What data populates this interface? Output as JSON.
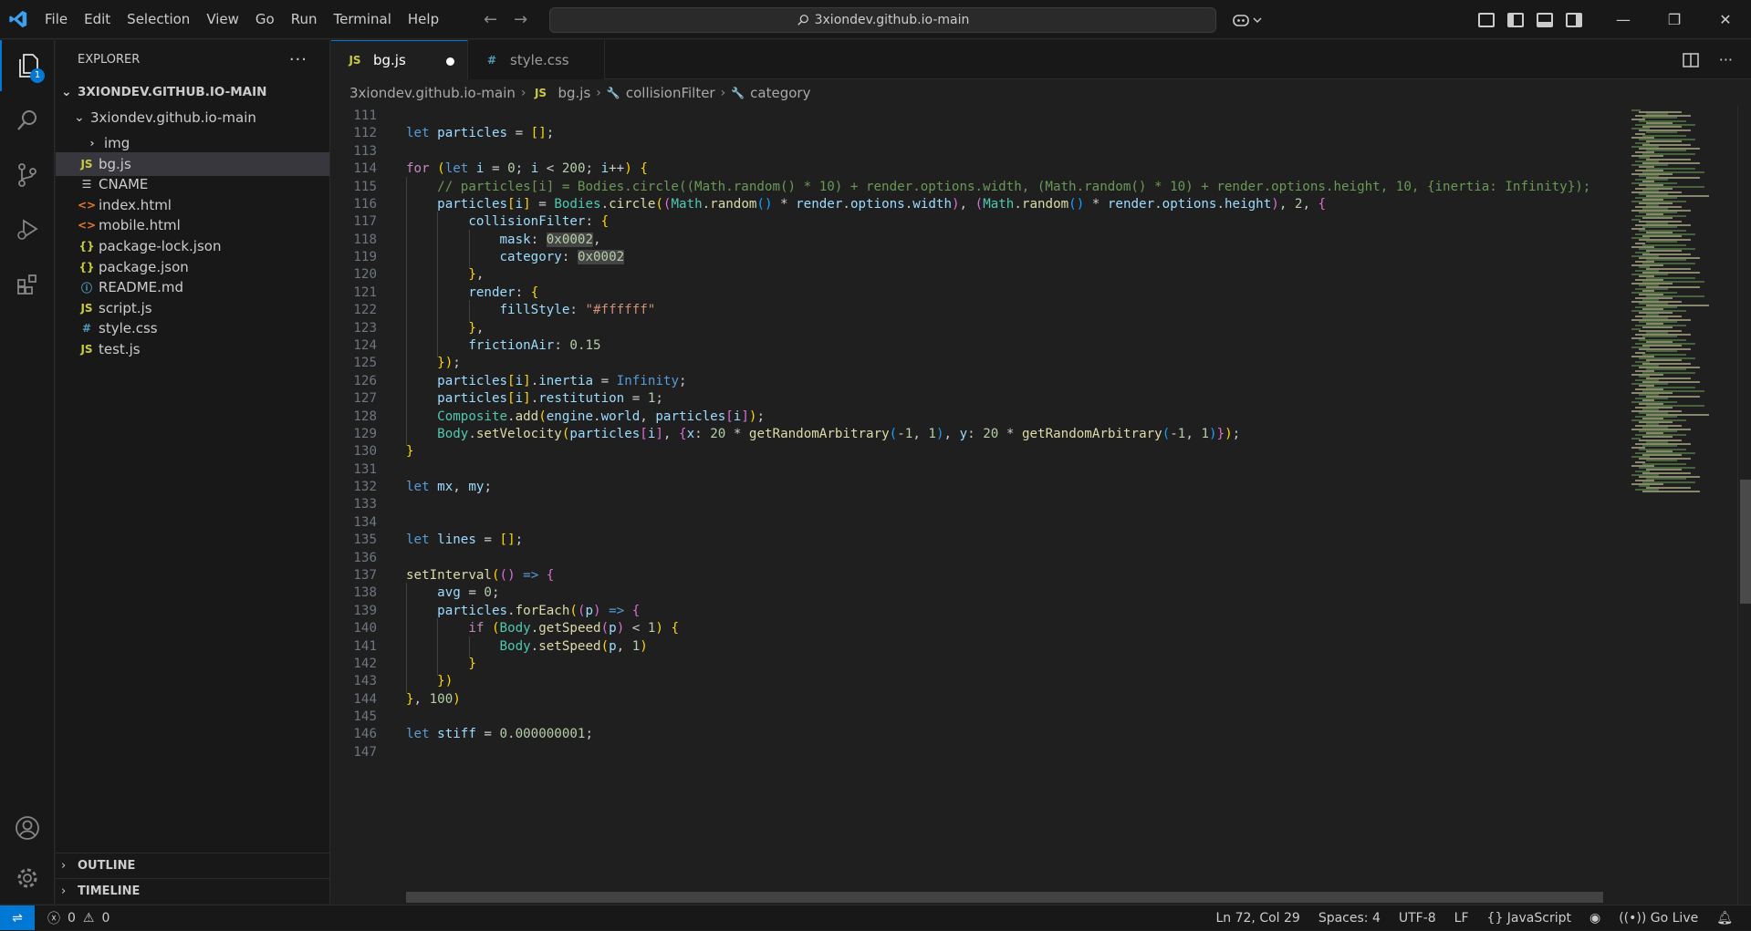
{
  "titlebar": {
    "menu": [
      "File",
      "Edit",
      "Selection",
      "View",
      "Go",
      "Run",
      "Terminal",
      "Help"
    ],
    "search_text": "3xiondev.github.io-main",
    "back_glyph": "←",
    "forward_glyph": "→",
    "window_controls": [
      "—",
      "❐",
      "✕"
    ]
  },
  "activity": {
    "explorer_badge": "1",
    "icons": [
      "files-icon",
      "search-icon",
      "source-control-icon",
      "run-debug-icon",
      "extensions-icon",
      "account-icon",
      "settings-gear-icon"
    ]
  },
  "sidebar": {
    "title": "EXPLORER",
    "more": "···",
    "root": "3XIONDEV.GITHUB.IO-MAIN",
    "folder": "3xiondev.github.io-main",
    "items": [
      {
        "label": "img",
        "icon": "›",
        "type": "folder"
      },
      {
        "label": "bg.js",
        "icon": "JS",
        "type": "js"
      },
      {
        "label": "CNAME",
        "icon": "☰",
        "type": "txt"
      },
      {
        "label": "index.html",
        "icon": "<>",
        "type": "html"
      },
      {
        "label": "mobile.html",
        "icon": "<>",
        "type": "html"
      },
      {
        "label": "package-lock.json",
        "icon": "{}",
        "type": "json"
      },
      {
        "label": "package.json",
        "icon": "{}",
        "type": "json"
      },
      {
        "label": "README.md",
        "icon": "ⓘ",
        "type": "md"
      },
      {
        "label": "script.js",
        "icon": "JS",
        "type": "js"
      },
      {
        "label": "style.css",
        "icon": "#",
        "type": "css"
      },
      {
        "label": "test.js",
        "icon": "JS",
        "type": "js"
      }
    ],
    "outline": "OUTLINE",
    "timeline": "TIMELINE"
  },
  "tabs": [
    {
      "label": "bg.js",
      "icon": "JS"
    },
    {
      "label": "style.css",
      "icon": "#"
    }
  ],
  "breadcrumb": [
    "3xiondev.github.io-main",
    "bg.js",
    "collisionFilter",
    "category"
  ],
  "breadcrumb_icons": [
    "JS",
    "🔧",
    "🔧"
  ],
  "code_lines": [
    {
      "n": "111",
      "t": ""
    },
    {
      "n": "112",
      "t": "let particles = [];"
    },
    {
      "n": "113",
      "t": ""
    },
    {
      "n": "114",
      "t": "for (let i = 0; i < 200; i++) {"
    },
    {
      "n": "115",
      "t": "    // particles[i] = Bodies.circle((Math.random() * 10) + render.options.width, (Math.random() * 10) + render.options.height, 10, {inertia: Infinity});"
    },
    {
      "n": "116",
      "t": "    particles[i] = Bodies.circle((Math.random() * render.options.width), (Math.random() * render.options.height), 2, {"
    },
    {
      "n": "117",
      "t": "        collisionFilter: {"
    },
    {
      "n": "118",
      "t": "            mask: 0x0002,"
    },
    {
      "n": "119",
      "t": "            category: 0x0002"
    },
    {
      "n": "120",
      "t": "        },"
    },
    {
      "n": "121",
      "t": "        render: {"
    },
    {
      "n": "122",
      "t": "            fillStyle: \"#ffffff\""
    },
    {
      "n": "123",
      "t": "        },"
    },
    {
      "n": "124",
      "t": "        frictionAir: 0.15"
    },
    {
      "n": "125",
      "t": "    });"
    },
    {
      "n": "126",
      "t": "    particles[i].inertia = Infinity;"
    },
    {
      "n": "127",
      "t": "    particles[i].restitution = 1;"
    },
    {
      "n": "128",
      "t": "    Composite.add(engine.world, particles[i]);"
    },
    {
      "n": "129",
      "t": "    Body.setVelocity(particles[i], {x: 20 * getRandomArbitrary(-1, 1), y: 20 * getRandomArbitrary(-1, 1)});"
    },
    {
      "n": "130",
      "t": "}"
    },
    {
      "n": "131",
      "t": ""
    },
    {
      "n": "132",
      "t": "let mx, my;"
    },
    {
      "n": "133",
      "t": ""
    },
    {
      "n": "134",
      "t": ""
    },
    {
      "n": "135",
      "t": "let lines = [];"
    },
    {
      "n": "136",
      "t": ""
    },
    {
      "n": "137",
      "t": "setInterval(() => {"
    },
    {
      "n": "138",
      "t": "    avg = 0;"
    },
    {
      "n": "139",
      "t": "    particles.forEach((p) => {"
    },
    {
      "n": "140",
      "t": "        if (Body.getSpeed(p) < 1) {"
    },
    {
      "n": "141",
      "t": "            Body.setSpeed(p, 1)"
    },
    {
      "n": "142",
      "t": "        }"
    },
    {
      "n": "143",
      "t": "    })"
    },
    {
      "n": "144",
      "t": "}, 100)"
    },
    {
      "n": "145",
      "t": ""
    },
    {
      "n": "146",
      "t": "let stiff = 0.000000001;"
    },
    {
      "n": "147",
      "t": ""
    }
  ],
  "status": {
    "remote": "⇌",
    "errors": "0",
    "warnings": "0",
    "position": "Ln 72, Col 29",
    "spaces": "Spaces: 4",
    "encoding": "UTF-8",
    "eol": "LF",
    "language": "JavaScript",
    "golive": "Go Live"
  },
  "colors": {
    "accent": "#0078d4",
    "js_icon": "#cbcb41",
    "html_icon": "#e37933",
    "json_icon": "#cbcb41",
    "css_icon": "#519aba",
    "md_icon": "#519aba"
  }
}
